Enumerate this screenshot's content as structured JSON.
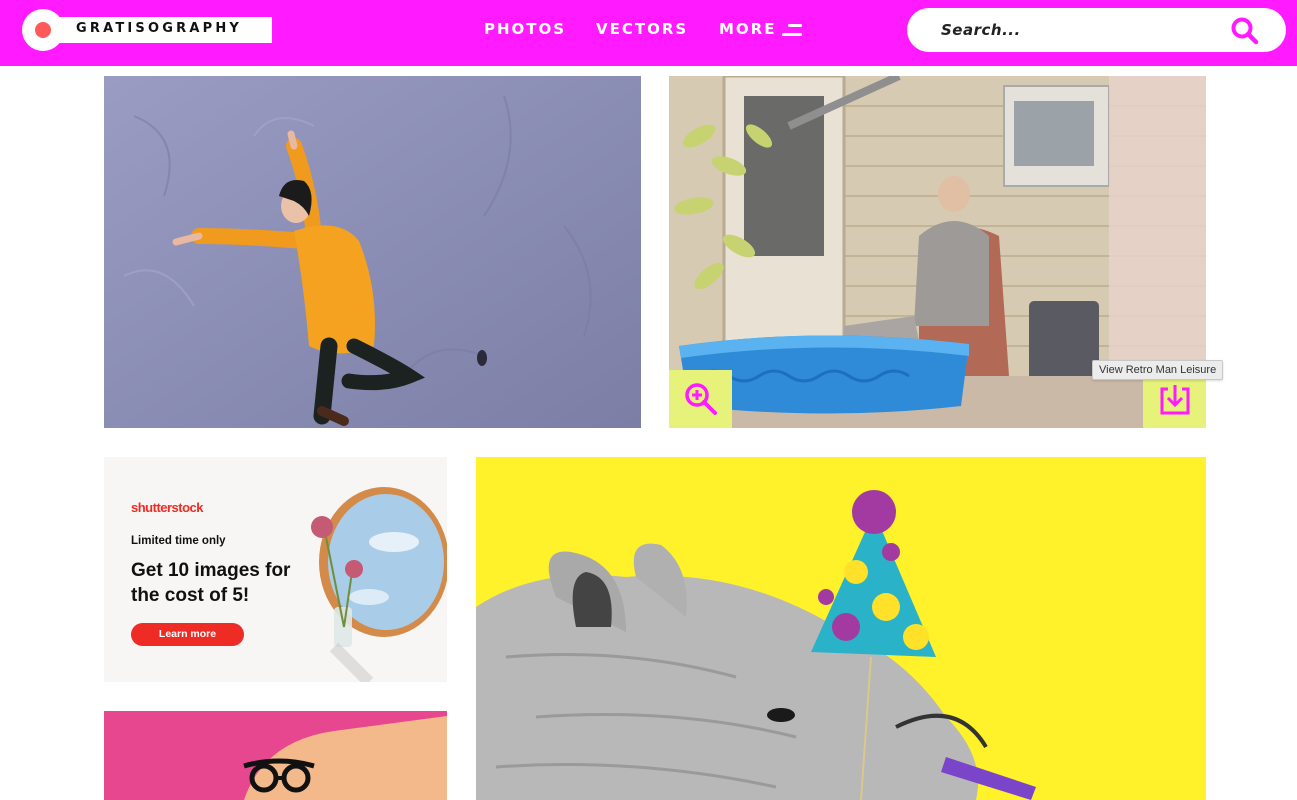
{
  "header": {
    "logo_text": "GRATISOGRAPHY",
    "nav": [
      {
        "label": "PHOTOS"
      },
      {
        "label": "VECTORS"
      },
      {
        "label": "MORE"
      }
    ],
    "search": {
      "placeholder": "Search..."
    },
    "colors": {
      "brand_pink": "#ff1aff",
      "logo_dot": "#ff5a5a"
    }
  },
  "photos": [
    {
      "icon": "dancer-photo"
    },
    {
      "icon": "retro-man-photo",
      "tooltip": "View Retro Man Leisure"
    },
    {
      "icon": "party-rhino-vector"
    },
    {
      "icon": "pink-disguise-vector"
    }
  ],
  "ad": {
    "brand": "shutterstock",
    "tagline": "Limited time only",
    "headline": "Get 10 images for the cost of 5!",
    "button": "Learn more",
    "colors": {
      "accent": "#ee2b24"
    }
  },
  "overlay_buttons": {
    "icons": [
      "zoom-in-icon",
      "download-icon"
    ],
    "color": "#e6f27a",
    "icon_color": "#ff1aff"
  }
}
